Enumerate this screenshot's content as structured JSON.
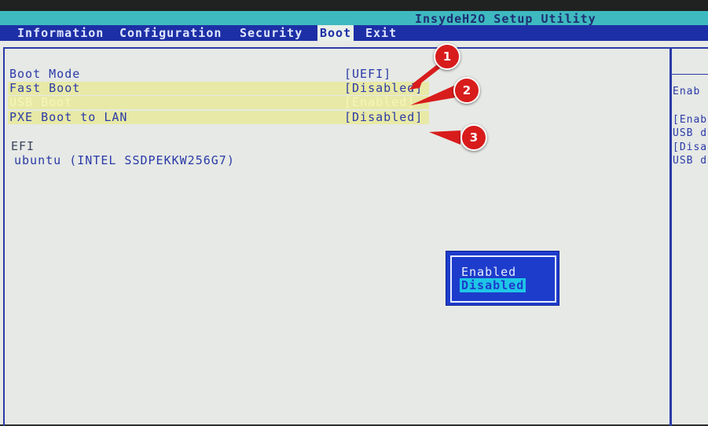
{
  "app": {
    "title": "InsydeH2O Setup Utility"
  },
  "menu": {
    "tabs": [
      {
        "label": "Information"
      },
      {
        "label": "Configuration"
      },
      {
        "label": "Security"
      },
      {
        "label": "Boot"
      },
      {
        "label": "Exit"
      }
    ],
    "active_tab": "Boot"
  },
  "settings": [
    {
      "label": "Boot Mode",
      "value": "[UEFI]"
    },
    {
      "label": "Fast Boot",
      "value": "[Disabled]"
    },
    {
      "label": "USB Boot",
      "value": "[Enabled]"
    },
    {
      "label": "PXE Boot to LAN",
      "value": "[Disabled]"
    }
  ],
  "boot_list": {
    "heading": "EFI",
    "entries": [
      "ubuntu (INTEL SSDPEKKW256G7)"
    ]
  },
  "help_panel": {
    "lines": [
      "Enab",
      "[Enab",
      "USB d",
      "[Disa",
      "USB d"
    ]
  },
  "popup": {
    "options": [
      "Enabled",
      "Disabled"
    ],
    "selected": "Disabled"
  },
  "annotations": {
    "markers": [
      "1",
      "2",
      "3"
    ],
    "color": "#d81c1c"
  },
  "colors": {
    "title_bar": "#3fb9c0",
    "menu_bar": "#1d2fa6",
    "text": "#2b3aa8",
    "highlight_row": "#e8e9a6",
    "popup_bg": "#1d3ccc",
    "popup_selected": "#1ec6e6"
  }
}
